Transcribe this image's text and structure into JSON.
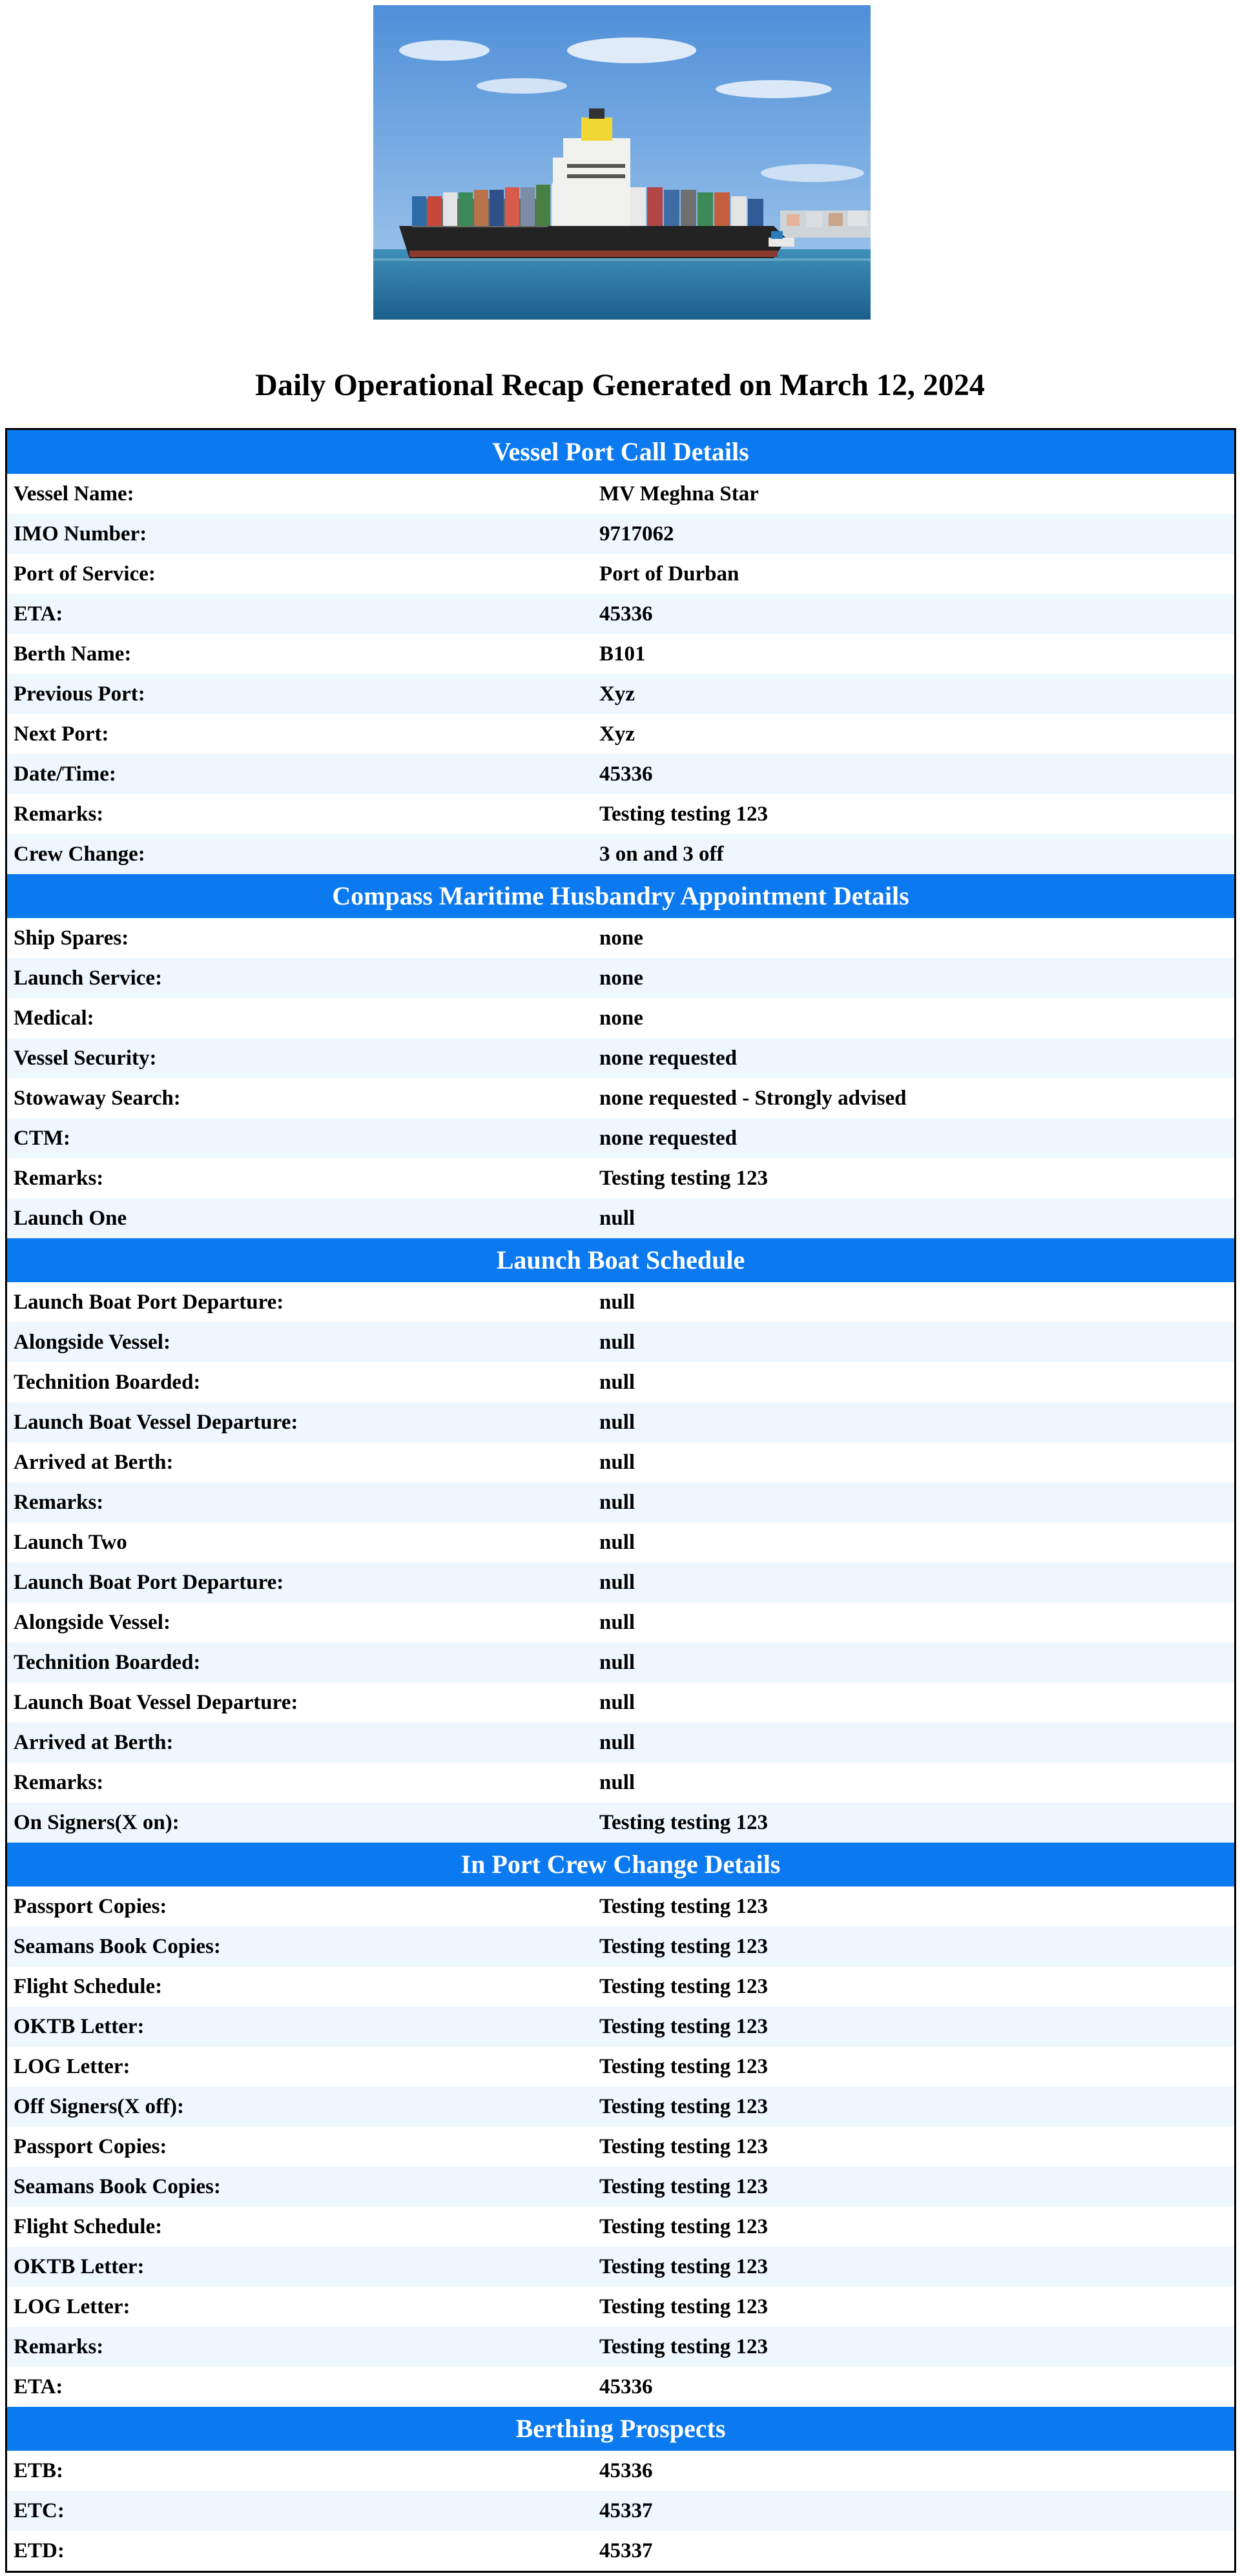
{
  "report": {
    "title": "Daily Operational Recap Generated on March 12, 2024"
  },
  "sections": [
    {
      "id": "vessel-port-call-details",
      "title": "Vessel Port Call Details",
      "rows": [
        {
          "label": "Vessel Name:",
          "value": "MV Meghna Star"
        },
        {
          "label": "IMO Number:",
          "value": "9717062"
        },
        {
          "label": "Port of Service:",
          "value": "Port of Durban"
        },
        {
          "label": "ETA:",
          "value": "45336"
        },
        {
          "label": "Berth Name:",
          "value": "B101"
        },
        {
          "label": "Previous Port:",
          "value": "Xyz"
        },
        {
          "label": "Next Port:",
          "value": "Xyz"
        },
        {
          "label": "Date/Time:",
          "value": "45336"
        },
        {
          "label": "Remarks:",
          "value": "Testing testing 123"
        },
        {
          "label": "Crew Change:",
          "value": "3 on and 3 off"
        }
      ]
    },
    {
      "id": "husbandry-appointment-details",
      "title": "Compass Maritime Husbandry Appointment Details",
      "rows": [
        {
          "label": "Ship Spares:",
          "value": "none"
        },
        {
          "label": "Launch Service:",
          "value": "none"
        },
        {
          "label": "Medical:",
          "value": "none"
        },
        {
          "label": "Vessel Security:",
          "value": "none requested"
        },
        {
          "label": "Stowaway Search:",
          "value": "none requested - Strongly advised"
        },
        {
          "label": "CTM:",
          "value": "none requested"
        },
        {
          "label": "Remarks:",
          "value": "Testing testing 123"
        },
        {
          "label": "Launch One",
          "value": "null"
        }
      ]
    },
    {
      "id": "launch-boat-schedule",
      "title": "Launch Boat Schedule",
      "rows": [
        {
          "label": "Launch Boat Port Departure:",
          "value": "null"
        },
        {
          "label": "Alongside Vessel:",
          "value": "null"
        },
        {
          "label": "Technition Boarded:",
          "value": "null"
        },
        {
          "label": "Launch Boat Vessel Departure:",
          "value": "null"
        },
        {
          "label": "Arrived at Berth:",
          "value": "null"
        },
        {
          "label": "Remarks:",
          "value": "null"
        },
        {
          "label": "Launch Two",
          "value": "null"
        },
        {
          "label": "Launch Boat Port Departure:",
          "value": "null"
        },
        {
          "label": "Alongside Vessel:",
          "value": "null"
        },
        {
          "label": "Technition Boarded:",
          "value": "null"
        },
        {
          "label": "Launch Boat Vessel Departure:",
          "value": "null"
        },
        {
          "label": "Arrived at Berth:",
          "value": "null"
        },
        {
          "label": "Remarks:",
          "value": "null"
        },
        {
          "label": "On Signers(X on):",
          "value": "Testing testing 123"
        }
      ]
    },
    {
      "id": "in-port-crew-change-details",
      "title": "In Port Crew Change Details",
      "rows": [
        {
          "label": "Passport Copies:",
          "value": "Testing testing 123"
        },
        {
          "label": "Seamans Book Copies:",
          "value": "Testing testing 123"
        },
        {
          "label": "Flight Schedule:",
          "value": "Testing testing 123"
        },
        {
          "label": "OKTB Letter:",
          "value": "Testing testing 123"
        },
        {
          "label": "LOG Letter:",
          "value": "Testing testing 123"
        },
        {
          "label": "Off Signers(X off):",
          "value": "Testing testing 123"
        },
        {
          "label": "Passport Copies:",
          "value": "Testing testing 123"
        },
        {
          "label": "Seamans Book Copies:",
          "value": "Testing testing 123"
        },
        {
          "label": "Flight Schedule:",
          "value": "Testing testing 123"
        },
        {
          "label": "OKTB Letter:",
          "value": "Testing testing 123"
        },
        {
          "label": "LOG Letter:",
          "value": "Testing testing 123"
        },
        {
          "label": "Remarks:",
          "value": "Testing testing 123"
        },
        {
          "label": "ETA:",
          "value": "45336"
        }
      ]
    },
    {
      "id": "berthing-prospects",
      "title": "Berthing Prospects",
      "rows": [
        {
          "label": "ETB:",
          "value": "45336"
        },
        {
          "label": "ETC:",
          "value": "45337"
        },
        {
          "label": "ETD:",
          "value": "45337"
        }
      ]
    }
  ],
  "colors": {
    "section_header_bg": "#0b79f0",
    "section_header_text": "#ffffff",
    "row_even_bg": "#ffffff",
    "row_odd_bg": "#eef6fe"
  }
}
